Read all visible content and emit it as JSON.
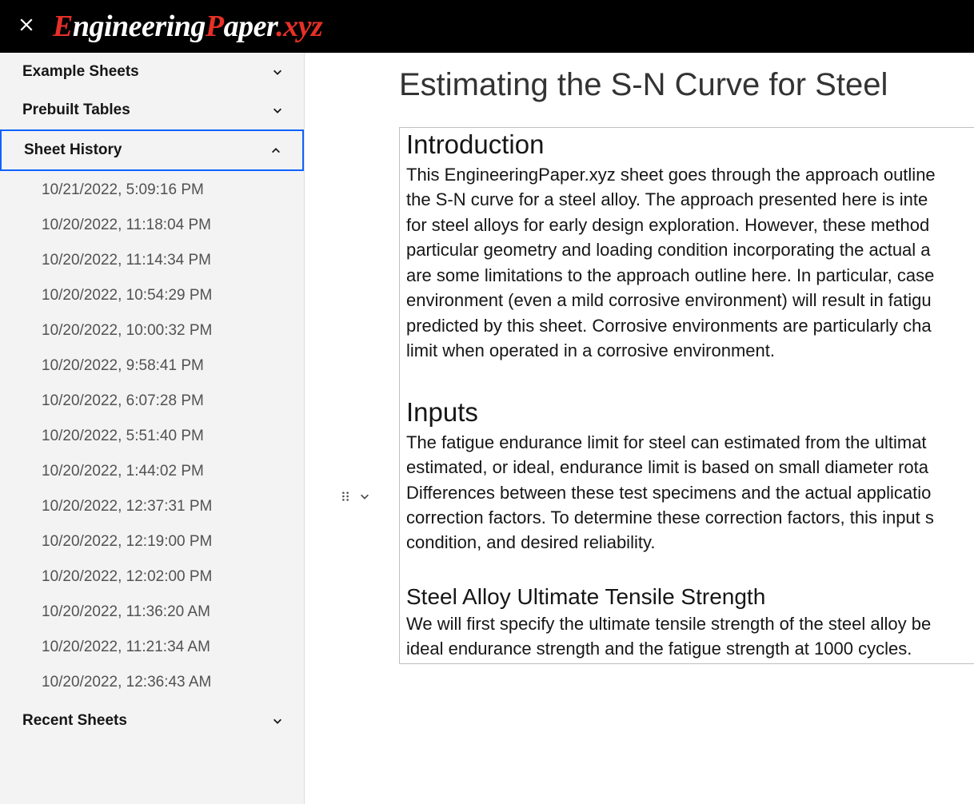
{
  "logo": {
    "part1": "E",
    "part2": "ngineering",
    "part3": "P",
    "part4": "aper",
    "part5": ".xyz"
  },
  "sidebar": {
    "sections": [
      {
        "label": "Example Sheets",
        "expanded": false
      },
      {
        "label": "Prebuilt Tables",
        "expanded": false
      },
      {
        "label": "Sheet History",
        "expanded": true
      },
      {
        "label": "Recent Sheets",
        "expanded": false
      }
    ],
    "history": [
      "10/21/2022, 5:09:16 PM",
      "10/20/2022, 11:18:04 PM",
      "10/20/2022, 11:14:34 PM",
      "10/20/2022, 10:54:29 PM",
      "10/20/2022, 10:00:32 PM",
      "10/20/2022, 9:58:41 PM",
      "10/20/2022, 6:07:28 PM",
      "10/20/2022, 5:51:40 PM",
      "10/20/2022, 1:44:02 PM",
      "10/20/2022, 12:37:31 PM",
      "10/20/2022, 12:19:00 PM",
      "10/20/2022, 12:02:00 PM",
      "10/20/2022, 11:36:20 AM",
      "10/20/2022, 11:21:34 AM",
      "10/20/2022, 12:36:43 AM"
    ]
  },
  "document": {
    "title": "Estimating the S-N Curve for Steel",
    "section_intro_heading": "Introduction",
    "intro_lines": [
      "This EngineeringPaper.xyz sheet goes through the approach outline",
      "the S-N curve for a steel alloy. The approach presented here is inte",
      "for steel alloys for early design exploration. However, these method",
      "particular geometry and loading condition incorporating the actual a",
      "are some limitations to the approach outline here. In particular, case",
      "environment (even a mild corrosive environment) will result in fatigu",
      "predicted by this sheet. Corrosive environments are particularly cha",
      "limit when operated in a corrosive environment."
    ],
    "section_inputs_heading": "Inputs",
    "inputs_lines": [
      "The fatigue endurance limit for steel can estimated from the ultimat",
      "estimated, or ideal, endurance limit is based on small diameter rota",
      "Differences between these test specimens and the actual applicatio",
      "correction factors. To determine these correction factors, this input s",
      "condition, and desired reliability."
    ],
    "section_tensile_heading": "Steel Alloy Ultimate Tensile Strength",
    "tensile_lines": [
      "We will first specify the ultimate tensile strength of the steel alloy be",
      "ideal endurance strength and the fatigue strength at 1000 cycles."
    ]
  }
}
